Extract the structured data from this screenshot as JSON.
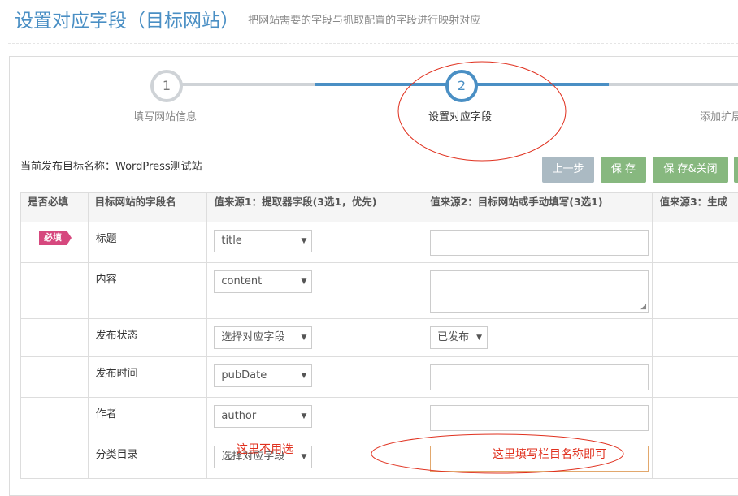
{
  "header": {
    "title": "设置对应字段（目标网站）",
    "subtitle": "把网站需要的字段与抓取配置的字段进行映射对应"
  },
  "steps": [
    {
      "number": "1",
      "label": "填写网站信息"
    },
    {
      "number": "2",
      "label": "设置对应字段"
    },
    {
      "number": "",
      "label": "添加扩展"
    }
  ],
  "active_step": 2,
  "target_name": "当前发布目标名称：WordPress测试站",
  "buttons": {
    "prev": "上一步",
    "save": "保 存",
    "save_close": "保 存&关闭"
  },
  "table": {
    "headers": [
      "是否必填",
      "目标网站的字段名",
      "值来源1：提取器字段(3选1，优先)",
      "值来源2：目标网站或手动填写(3选1)",
      "值来源3：生成"
    ],
    "rows": [
      {
        "required": "必填",
        "name": "标题",
        "source1": "title",
        "source2_type": "input",
        "source2_value": ""
      },
      {
        "required": "",
        "name": "内容",
        "source1": "content",
        "source2_type": "textarea",
        "source2_value": ""
      },
      {
        "required": "",
        "name": "发布状态",
        "source1": "选择对应字段",
        "source2_type": "select",
        "source2_value": "已发布"
      },
      {
        "required": "",
        "name": "发布时间",
        "source1": "pubDate",
        "source2_type": "input",
        "source2_value": ""
      },
      {
        "required": "",
        "name": "作者",
        "source1": "author",
        "source2_type": "input",
        "source2_value": ""
      },
      {
        "required": "",
        "name": "分类目录",
        "source1": "选择对应字段",
        "source2_type": "input",
        "source2_value": ""
      }
    ]
  },
  "annotations": {
    "source1_note": "这里不用选",
    "source2_note": "这里填写栏目名称即可",
    "color": "#e0301e"
  },
  "colors": {
    "accent": "#4a8fc4",
    "save_green": "#87b87f",
    "prev_gray": "#abbac3",
    "required_badge": "#d6487e"
  }
}
